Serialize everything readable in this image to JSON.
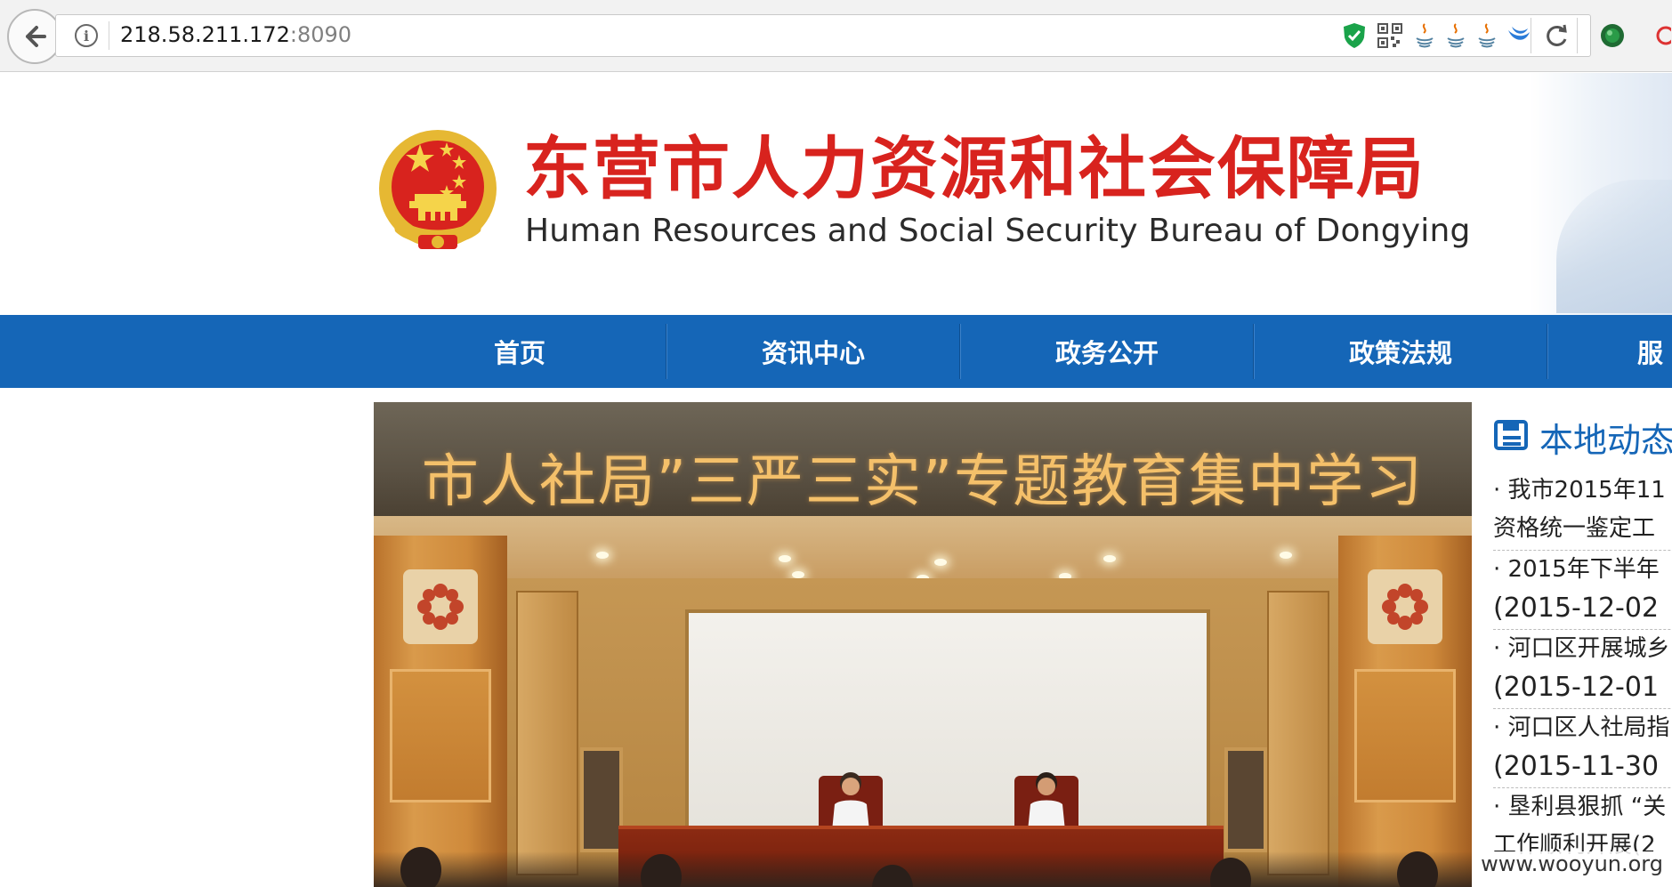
{
  "browser": {
    "url_host": "218.58.211.172",
    "url_port": ":8090",
    "toolbar_icons": [
      "shield-check-icon",
      "qr-code-icon",
      "java-icon",
      "java-icon",
      "java-icon",
      "moon-icon",
      "reload-icon",
      "extension-globe-icon"
    ]
  },
  "header": {
    "title_cn": "东营市人力资源和社会保障局",
    "title_en": "Human Resources and Social Security Bureau of Dongying"
  },
  "nav": {
    "items": [
      {
        "label": "首页"
      },
      {
        "label": "资讯中心"
      },
      {
        "label": "政务公开"
      },
      {
        "label": "政策法规"
      },
      {
        "label": "服"
      }
    ]
  },
  "banner": {
    "title": "市人社局”三严三实”专题教育集中学习"
  },
  "sidebar": {
    "title": "本地动态",
    "news": [
      {
        "line1": "· 我市2015年11",
        "line2": "资格统一鉴定工"
      },
      {
        "line1": "· 2015年下半年",
        "line2": "(2015-12-02"
      },
      {
        "line1": "· 河口区开展城乡",
        "line2": "(2015-12-01"
      },
      {
        "line1": "· 河口区人社局指",
        "line2": "(2015-11-30"
      },
      {
        "line1": "· 垦利县狠抓 “关",
        "line2": "工作顺利开展(2"
      }
    ]
  },
  "watermark": "www.wooyun.org",
  "colors": {
    "nav_blue": "#1566b7",
    "title_red": "#d8231e",
    "banner_text": "#f4c06a"
  }
}
